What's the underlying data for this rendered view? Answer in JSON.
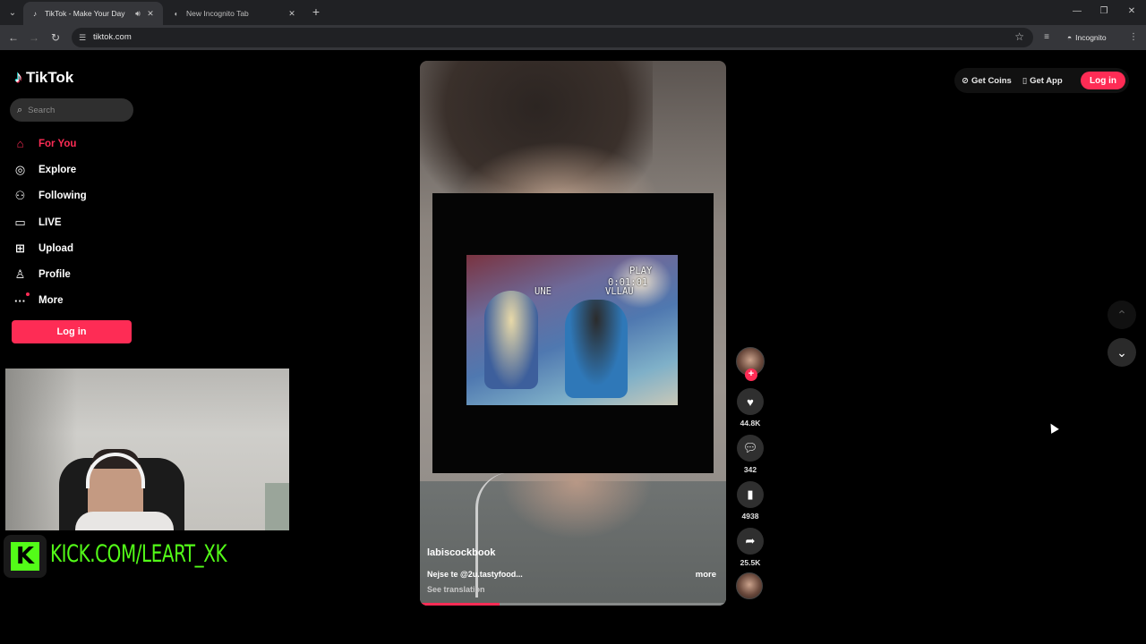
{
  "browser": {
    "tabs": [
      {
        "title": "TikTok - Make Your Day",
        "active": true
      },
      {
        "title": "New Incognito Tab",
        "active": false
      }
    ],
    "url": "tiktok.com",
    "mode_label": "Incognito"
  },
  "sidebar": {
    "logo": "TikTok",
    "search_placeholder": "Search",
    "items": [
      {
        "label": "For You",
        "icon": "home-icon",
        "active": true
      },
      {
        "label": "Explore",
        "icon": "compass-icon",
        "active": false
      },
      {
        "label": "Following",
        "icon": "following-icon",
        "active": false
      },
      {
        "label": "LIVE",
        "icon": "live-icon",
        "active": false
      },
      {
        "label": "Upload",
        "icon": "upload-icon",
        "active": false
      },
      {
        "label": "Profile",
        "icon": "profile-icon",
        "active": false
      },
      {
        "label": "More",
        "icon": "more-icon",
        "active": false
      }
    ],
    "login_label": "Log in"
  },
  "overlay": {
    "kick_text": "KICK.COM/LEART_XK"
  },
  "video": {
    "clip_labels": {
      "play": "PLAY",
      "time": "0:01:01",
      "left": "UNE",
      "right": "VLLAU"
    },
    "username": "labiscockbook",
    "caption": "Nejse te @2u.tastyfood...",
    "more_label": "more",
    "translate_label": "See translation",
    "progress": 0.26
  },
  "actions": {
    "likes": "44.8K",
    "comments": "342",
    "saves": "4938",
    "shares": "25.5K"
  },
  "topbar": {
    "coins_label": "Get Coins",
    "app_label": "Get App",
    "login_label": "Log in"
  },
  "colors": {
    "accent": "#fe2c55",
    "kick_green": "#53fc18"
  }
}
